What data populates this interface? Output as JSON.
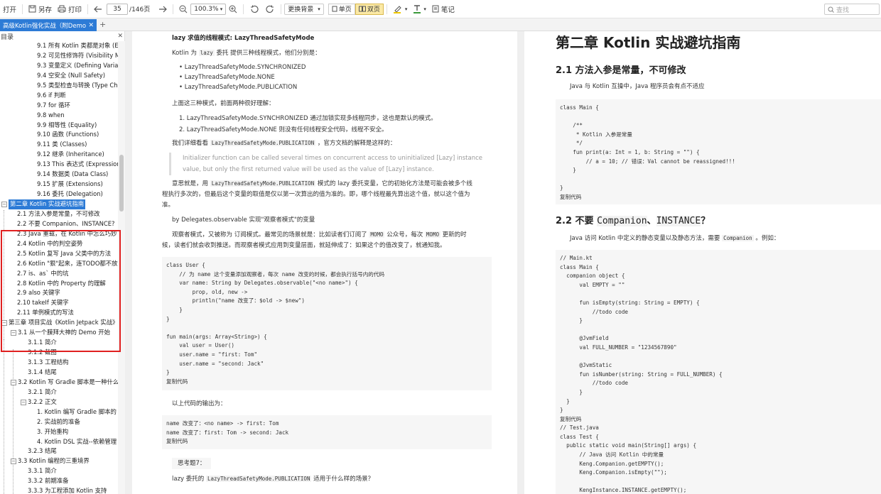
{
  "toolbar": {
    "open": "打开",
    "save_as": "另存",
    "print": "打印",
    "page_current": "35",
    "page_total": "/146页",
    "zoom": "100.3%",
    "background": "更换背景",
    "single": "单页",
    "double": "双页",
    "note": "笔记",
    "search_placeholder": "查找"
  },
  "tab": {
    "title": "高级Kotlin强化实战（附Demo"
  },
  "sidebar": {
    "title": "目录",
    "items": [
      {
        "label": "9.1 所有 Kotlin 类都是对象 (E",
        "indent": 52
      },
      {
        "label": "9.2 可见性修饰符 (Visibility M",
        "indent": 52
      },
      {
        "label": "9.3 变量定义 (Defining Variab",
        "indent": 52
      },
      {
        "label": "9.4 空安全 (Null Safety)",
        "indent": 52
      },
      {
        "label": "9.5 类型检查与转换 (Type Ch",
        "indent": 52
      },
      {
        "label": "9.6 if 判断",
        "indent": 52
      },
      {
        "label": "9.7 for 循环",
        "indent": 52
      },
      {
        "label": "9.8 when",
        "indent": 52
      },
      {
        "label": "9.9 相等性 (Equality)",
        "indent": 52
      },
      {
        "label": "9.10 函数 (Functions)",
        "indent": 52
      },
      {
        "label": "9.11 类 (Classes)",
        "indent": 52
      },
      {
        "label": "9.12 继承 (Inheritance)",
        "indent": 52
      },
      {
        "label": "9.13 This 表达式 (Expression",
        "indent": 52
      },
      {
        "label": "9.14 数据类 (Data Class)",
        "indent": 52
      },
      {
        "label": "9.15 扩展 (Extensions)",
        "indent": 52
      },
      {
        "label": "9.16 委托 (Delegation)",
        "indent": 52
      },
      {
        "label": "第二章 Kotlin 实战避坑指南",
        "indent": 12,
        "toggle": "−",
        "selected": true
      },
      {
        "label": "2.1 方法入参是常量，不可修改",
        "indent": 24
      },
      {
        "label": "2.2 不要 Companion、INSTANCE?",
        "indent": 24
      },
      {
        "label": "2.3 Java 重载，在 Kotlin 中怎么巧妙",
        "indent": 24
      },
      {
        "label": "2.4 Kotlin 中的判空姿势",
        "indent": 24
      },
      {
        "label": "2.5 Kotlin 复写 Java 父类中的方法",
        "indent": 24
      },
      {
        "label": "2.6 Kotlin \"狠\"起来，连TODO都不放",
        "indent": 24
      },
      {
        "label": "2.7 is、as` 中的坑",
        "indent": 24
      },
      {
        "label": "2.8 Kotlin 中的 Property 的理解",
        "indent": 24
      },
      {
        "label": "2.9 also 关键字",
        "indent": 24
      },
      {
        "label": "2.10 takeIf 关键字",
        "indent": 24
      },
      {
        "label": "2.11 单例模式的写法",
        "indent": 24
      },
      {
        "label": "第三章 项目实战《Kotlin Jetpack 实战》",
        "indent": 12,
        "toggle": "−"
      },
      {
        "label": "3.1 从一个膜拜大神的 Demo 开始",
        "indent": 25,
        "toggle": "−"
      },
      {
        "label": "3.1.1 简介",
        "indent": 39
      },
      {
        "label": "3.1.2 截图",
        "indent": 39
      },
      {
        "label": "3.1.3 工程结构",
        "indent": 39
      },
      {
        "label": "3.1.4 结尾",
        "indent": 39
      },
      {
        "label": "3.2 Kotlin 写 Gradle 脚本是一种什么",
        "indent": 25,
        "toggle": "−"
      },
      {
        "label": "3.2.1 简介",
        "indent": 39
      },
      {
        "label": "3.2.2 正文",
        "indent": 39,
        "toggle": "−"
      },
      {
        "label": "1. Kotlin 编写 Gradle 脚本的",
        "indent": 52
      },
      {
        "label": "2. 实战前的准备",
        "indent": 52
      },
      {
        "label": "3. 开始重构",
        "indent": 52
      },
      {
        "label": "4. Kotlin DSL 实战--依赖管理",
        "indent": 52
      },
      {
        "label": "3.2.3 结尾",
        "indent": 39
      },
      {
        "label": "3.3 Kotlin 编程的三重境界",
        "indent": 25,
        "toggle": "−"
      },
      {
        "label": "3.3.1 简介",
        "indent": 39
      },
      {
        "label": "3.3.2 前期准备",
        "indent": 39
      },
      {
        "label": "3.3.3 为工程添加 Kotlin 支持",
        "indent": 39
      }
    ]
  },
  "left_page": {
    "heading": "lazy 求值的线程模式: LazyThreadSafetyMode",
    "intro_a": "Kotlin 为",
    "intro_code": "lazy",
    "intro_b": "委托 提供三种线程模式，他们分别是：",
    "modes": [
      "LazyThreadSafetyMode.SYNCHRONIZED",
      "LazyThreadSafetyMode.NONE",
      "LazyThreadSafetyMode.PUBLICATION"
    ],
    "understand": "上面这三种模式，前面两种很好理解：",
    "ol": [
      "1. LazyThreadSafetyMode.SYNCHRONIZED 通过加锁实现多线程同步，这也是默认的模式。",
      "2. LazyThreadSafetyMode.NONE 则没有任何线程安全代码，线程不安全。"
    ],
    "detail_a": "我们详细看看",
    "detail_code": "LazyThreadSafetyMode.PUBLICATION",
    "detail_b": "，官方文档的解释是这样的：",
    "quote_1": "Initializer function can be called several times on concurrent access to uninitialized [Lazy] instance",
    "quote_2": "value, but only the first returned value will be used as the value of [Lazy] instance.",
    "meaning_1a": "意思就是，用",
    "meaning_code": "LazyThreadSafetyMode.PUBLICATION",
    "meaning_1b": "模式的 lazy 委托变量，它的初始化方法是可能会被多个线",
    "meaning_2": "程执行多次的，但最后这个变量的取值是仅以第一次算出的值为准的。即，哪个线程最先算出这个值，就以这个值为",
    "meaning_3": "准。",
    "observable": "by Delegates.observable 实现\"观察者模式\"的变量",
    "observer_1a": "观察者模式，又被称为 订阅模式。最常见的场景就是：比如读者们订阅了",
    "observer_momo1": "MOMO",
    "observer_1b": "公众号，每次",
    "observer_momo2": "MOMO",
    "observer_1c": "更新的时",
    "observer_2": "候，读者们就会收到推送。而观察者模式应用到变量层面，就延伸成了：如果这个的值改变了，就通知我。",
    "code1": [
      "class User {",
      "    // 为 name 这个变量添加观察者，每次 name 改变的时候，都会执行括号内的代码",
      "    var name: String by Delegates.observable(\"<no name>\") {",
      "        prop, old, new ->",
      "        println(\"name 改变了：$old -> $new\")",
      "    }",
      "}",
      "",
      "fun main(args: Array<String>) {",
      "    val user = User()",
      "    user.name = \"first: Tom\"",
      "    user.name = \"second: Jack\"",
      "}",
      "复制代码"
    ],
    "output_label": "以上代码的输出为：",
    "code2": [
      "name 改变了：<no name> -> first: Tom",
      "name 改变了：first: Tom -> second: Jack",
      "复制代码"
    ],
    "think": "思考题7：",
    "question_a": "lazy 委托的",
    "question_code": "LazyThreadSafetyMode.PUBLICATION",
    "question_b": "适用于什么样的场景？"
  },
  "right_page": {
    "h1": "第二章 Kotlin 实战避坑指南",
    "h2_1": "2.1 方法入参是常量，不可修改",
    "p1": "Java 与 Kotlin 互操中，Java 程序员会有点不适应",
    "code1": [
      "class Main {",
      "",
      "    /**",
      "     * Kotlin 入参是常量",
      "     */",
      "    fun print(a: Int = 1, b: String = \"\") {",
      "        // a = 10; // 错误：Val cannot be reassigned!!!",
      "    }",
      "",
      "}",
      "复制代码"
    ],
    "h2_2a": "2.2 不要",
    "h2_2code1": "Companion",
    "h2_2b": "、",
    "h2_2code2": "INSTANCE",
    "h2_2c": "？",
    "p2a": "Java 访问 Kotlin 中定义的静态变量以及静态方法，需要",
    "p2code": "Companion",
    "p2b": "。例如：",
    "code2": [
      "// Main.kt",
      "class Main {",
      "  companion object {",
      "      val EMPTY = \"\"",
      "",
      "      fun isEmpty(string: String = EMPTY) {",
      "          //todo code",
      "      }",
      "",
      "      @JvmField",
      "      val FULL_NUMBER = \"1234567890\"",
      "",
      "      @JvmStatic",
      "      fun isNumber(string: String = FULL_NUMBER) {",
      "          //todo code",
      "      }",
      "  }",
      "}",
      "复制代码",
      "// Test.java",
      "class Test {",
      "  public static void main(String[] args) {",
      "      // Java 访问 Kotlin 中的常量",
      "      Keng.Companion.getEMPTY();",
      "      Keng.Companion.isEmpty(\"\");",
      "",
      "      KengInstance.INSTANCE.getEMPTY();"
    ]
  }
}
